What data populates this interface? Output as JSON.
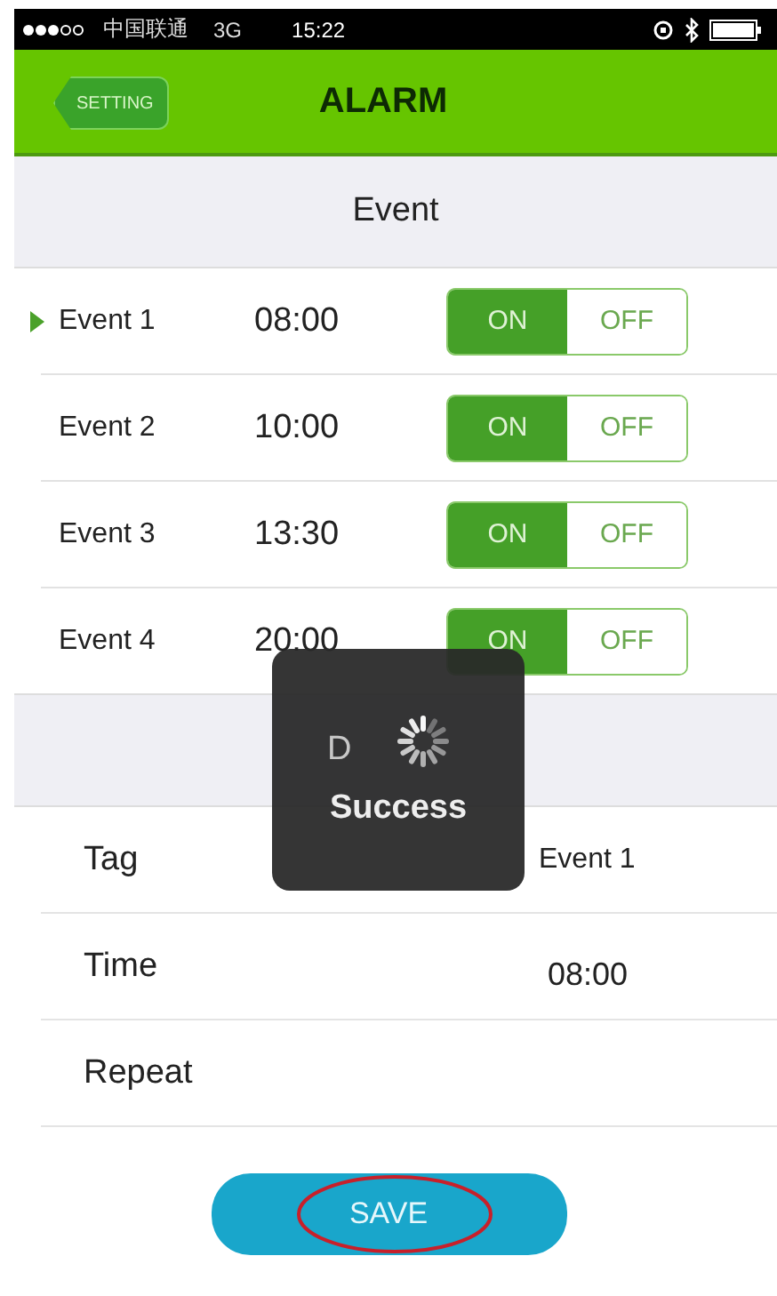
{
  "status_bar": {
    "carrier": "中国联通",
    "network": "3G",
    "time": "15:22"
  },
  "nav": {
    "back": "SETTING",
    "title": "ALARM"
  },
  "event_section": {
    "title": "Event"
  },
  "events": [
    {
      "name": "Event 1",
      "time": "08:00",
      "selected": true,
      "on": true,
      "on_label": "ON",
      "off_label": "OFF"
    },
    {
      "name": "Event 2",
      "time": "10:00",
      "selected": false,
      "on": true,
      "on_label": "ON",
      "off_label": "OFF"
    },
    {
      "name": "Event 3",
      "time": "13:30",
      "selected": false,
      "on": true,
      "on_label": "ON",
      "off_label": "OFF"
    },
    {
      "name": "Event 4",
      "time": "20:00",
      "selected": false,
      "on": true,
      "on_label": "ON",
      "off_label": "OFF"
    }
  ],
  "detail_section": {
    "title": "D"
  },
  "details": [
    {
      "label": "Tag",
      "value": "Event 1"
    },
    {
      "label": "Time",
      "value": "08:00"
    },
    {
      "label": "Repeat"
    }
  ],
  "save_button": "SAVE",
  "toast": {
    "message": "Success"
  }
}
